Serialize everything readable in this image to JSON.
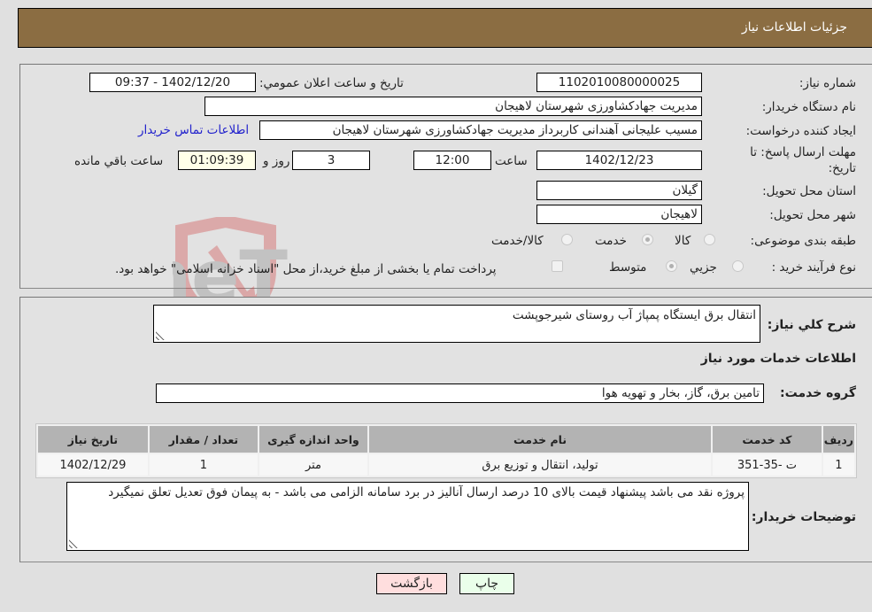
{
  "header": {
    "title": "جزئیات اطلاعات نیاز"
  },
  "form": {
    "need_number": {
      "label": "شماره نیاز:",
      "value": "1102010080000025"
    },
    "announce_datetime": {
      "label": "تاريخ و ساعت اعلان عمومي:",
      "value": "1402/12/20 - 09:37"
    },
    "buyer_org": {
      "label": "نام دستگاه خریدار:",
      "value": "مدیریت جهادکشاورزی شهرستان لاهیجان"
    },
    "requester": {
      "label": "ایجاد کننده درخواست:",
      "value": "مسیب علیجانی آهندانی کاربرداز مدیریت جهادکشاورزی شهرستان لاهیجان"
    },
    "buyer_contact_link": "اطلاعات تماس خریدار",
    "deadline": {
      "label_line1": "مهلت ارسال پاسخ: تا",
      "label_line2": "تاریخ:",
      "date": "1402/12/23",
      "time_label": "ساعت",
      "time": "12:00",
      "days": "3",
      "days_label": "روز و",
      "remaining": "01:09:39",
      "remaining_label": "ساعت باقي مانده"
    },
    "province": {
      "label": "استان محل تحویل:",
      "value": "گیلان"
    },
    "city": {
      "label": "شهر محل تحویل:",
      "value": "لاهیجان"
    },
    "category": {
      "label": "طبقه بندی موضوعی:",
      "options": [
        "کالا",
        "خدمت",
        "کالا/خدمت"
      ],
      "selected": "خدمت"
    },
    "purchase_type": {
      "label": "نوع فرآیند خرید :",
      "options": [
        "جزیي",
        "متوسط"
      ],
      "selected": "متوسط",
      "treasury_note": "پرداخت تمام یا بخشی از مبلغ خرید،از محل \"اسناد خزانه اسلامی\" خواهد بود."
    }
  },
  "details": {
    "description_label": "شرح کلي نیاز:",
    "description_value": "انتقال برق ایستگاه پمپاژ آب روستای شیرجوپشت",
    "services_heading": "اطلاعات خدمات مورد نیاز",
    "service_group_label": "گروه خدمت:",
    "service_group_value": "تامین برق، گاز، بخار و تهویه هوا",
    "table": {
      "headers": [
        "ردیف",
        "کد خدمت",
        "نام خدمت",
        "واحد اندازه گیری",
        "تعداد / مقدار",
        "تاریخ نیاز"
      ],
      "rows": [
        [
          "1",
          "ت -35-351",
          "تولید، انتقال و توزیع برق",
          "متر",
          "1",
          "1402/12/29"
        ]
      ]
    },
    "buyer_notes_label": "توضیحات خریدار:",
    "buyer_notes_value": "پروژه نقد می باشد پیشنهاد قیمت بالای 10 درصد ارسال آنالیز در برد سامانه الزامی می باشد - به پیمان فوق تعدیل تعلق نمیگیرد"
  },
  "buttons": {
    "print": "چاپ",
    "back": "بازگشت"
  },
  "watermark": {
    "text": "AriaTender.neT"
  },
  "colors": {
    "header_bg": "#8b6d42",
    "print_btn": "#eaffea",
    "back_btn": "#ffdede",
    "link": "#2222cc"
  }
}
